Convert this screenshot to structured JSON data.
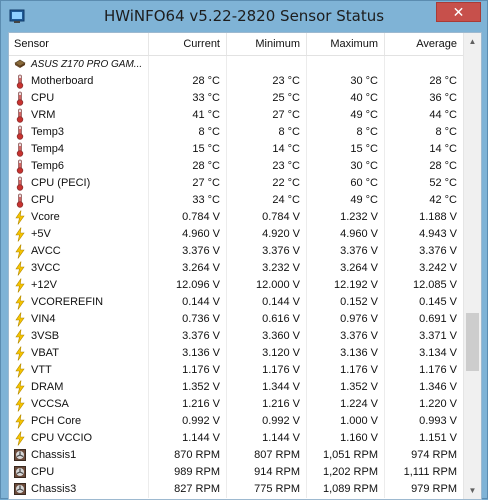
{
  "window": {
    "title": "HWiNFO64 v5.22-2820 Sensor Status",
    "close_symbol": "✕"
  },
  "columns": [
    "Sensor",
    "Current",
    "Minimum",
    "Maximum",
    "Average"
  ],
  "rows": [
    {
      "type": "group",
      "icon": "chip-icon",
      "name": "ASUS Z170 PRO GAM...",
      "cur": "",
      "min": "",
      "max": "",
      "avg": ""
    },
    {
      "type": "temp",
      "icon": "thermometer-icon",
      "name": "Motherboard",
      "cur": "28 °C",
      "min": "23 °C",
      "max": "30 °C",
      "avg": "28 °C"
    },
    {
      "type": "temp",
      "icon": "thermometer-icon",
      "name": "CPU",
      "cur": "33 °C",
      "min": "25 °C",
      "max": "40 °C",
      "avg": "36 °C"
    },
    {
      "type": "temp",
      "icon": "thermometer-icon",
      "name": "VRM",
      "cur": "41 °C",
      "min": "27 °C",
      "max": "49 °C",
      "avg": "44 °C"
    },
    {
      "type": "temp",
      "icon": "thermometer-icon",
      "name": "Temp3",
      "cur": "8 °C",
      "min": "8 °C",
      "max": "8 °C",
      "avg": "8 °C"
    },
    {
      "type": "temp",
      "icon": "thermometer-icon",
      "name": "Temp4",
      "cur": "15 °C",
      "min": "14 °C",
      "max": "15 °C",
      "avg": "14 °C"
    },
    {
      "type": "temp",
      "icon": "thermometer-icon",
      "name": "Temp6",
      "cur": "28 °C",
      "min": "23 °C",
      "max": "30 °C",
      "avg": "28 °C"
    },
    {
      "type": "temp",
      "icon": "thermometer-icon",
      "name": "CPU (PECI)",
      "cur": "27 °C",
      "min": "22 °C",
      "max": "60 °C",
      "avg": "52 °C"
    },
    {
      "type": "temp",
      "icon": "thermometer-icon",
      "name": "CPU",
      "cur": "33 °C",
      "min": "24 °C",
      "max": "49 °C",
      "avg": "42 °C"
    },
    {
      "type": "volt",
      "icon": "lightning-icon",
      "name": "Vcore",
      "cur": "0.784 V",
      "min": "0.784 V",
      "max": "1.232 V",
      "avg": "1.188 V"
    },
    {
      "type": "volt",
      "icon": "lightning-icon",
      "name": "+5V",
      "cur": "4.960 V",
      "min": "4.920 V",
      "max": "4.960 V",
      "avg": "4.943 V"
    },
    {
      "type": "volt",
      "icon": "lightning-icon",
      "name": "AVCC",
      "cur": "3.376 V",
      "min": "3.376 V",
      "max": "3.376 V",
      "avg": "3.376 V"
    },
    {
      "type": "volt",
      "icon": "lightning-icon",
      "name": "3VCC",
      "cur": "3.264 V",
      "min": "3.232 V",
      "max": "3.264 V",
      "avg": "3.242 V"
    },
    {
      "type": "volt",
      "icon": "lightning-icon",
      "name": "+12V",
      "cur": "12.096 V",
      "min": "12.000 V",
      "max": "12.192 V",
      "avg": "12.085 V"
    },
    {
      "type": "volt",
      "icon": "lightning-icon",
      "name": "VCOREREFIN",
      "cur": "0.144 V",
      "min": "0.144 V",
      "max": "0.152 V",
      "avg": "0.145 V"
    },
    {
      "type": "volt",
      "icon": "lightning-icon",
      "name": "VIN4",
      "cur": "0.736 V",
      "min": "0.616 V",
      "max": "0.976 V",
      "avg": "0.691 V"
    },
    {
      "type": "volt",
      "icon": "lightning-icon",
      "name": "3VSB",
      "cur": "3.376 V",
      "min": "3.360 V",
      "max": "3.376 V",
      "avg": "3.371 V"
    },
    {
      "type": "volt",
      "icon": "lightning-icon",
      "name": "VBAT",
      "cur": "3.136 V",
      "min": "3.120 V",
      "max": "3.136 V",
      "avg": "3.134 V"
    },
    {
      "type": "volt",
      "icon": "lightning-icon",
      "name": "VTT",
      "cur": "1.176 V",
      "min": "1.176 V",
      "max": "1.176 V",
      "avg": "1.176 V"
    },
    {
      "type": "volt",
      "icon": "lightning-icon",
      "name": "DRAM",
      "cur": "1.352 V",
      "min": "1.344 V",
      "max": "1.352 V",
      "avg": "1.346 V"
    },
    {
      "type": "volt",
      "icon": "lightning-icon",
      "name": "VCCSA",
      "cur": "1.216 V",
      "min": "1.216 V",
      "max": "1.224 V",
      "avg": "1.220 V"
    },
    {
      "type": "volt",
      "icon": "lightning-icon",
      "name": "PCH Core",
      "cur": "0.992 V",
      "min": "0.992 V",
      "max": "1.000 V",
      "avg": "0.993 V"
    },
    {
      "type": "volt",
      "icon": "lightning-icon",
      "name": "CPU VCCIO",
      "cur": "1.144 V",
      "min": "1.144 V",
      "max": "1.160 V",
      "avg": "1.151 V"
    },
    {
      "type": "fan",
      "icon": "fan-icon",
      "name": "Chassis1",
      "cur": "870 RPM",
      "min": "807 RPM",
      "max": "1,051 RPM",
      "avg": "974 RPM"
    },
    {
      "type": "fan",
      "icon": "fan-icon",
      "name": "CPU",
      "cur": "989 RPM",
      "min": "914 RPM",
      "max": "1,202 RPM",
      "avg": "1,111 RPM"
    },
    {
      "type": "fan",
      "icon": "fan-icon",
      "name": "Chassis3",
      "cur": "827 RPM",
      "min": "775 RPM",
      "max": "1,089 RPM",
      "avg": "979 RPM"
    }
  ],
  "scrollbar": {
    "up_symbol": "▲",
    "down_symbol": "▼"
  }
}
